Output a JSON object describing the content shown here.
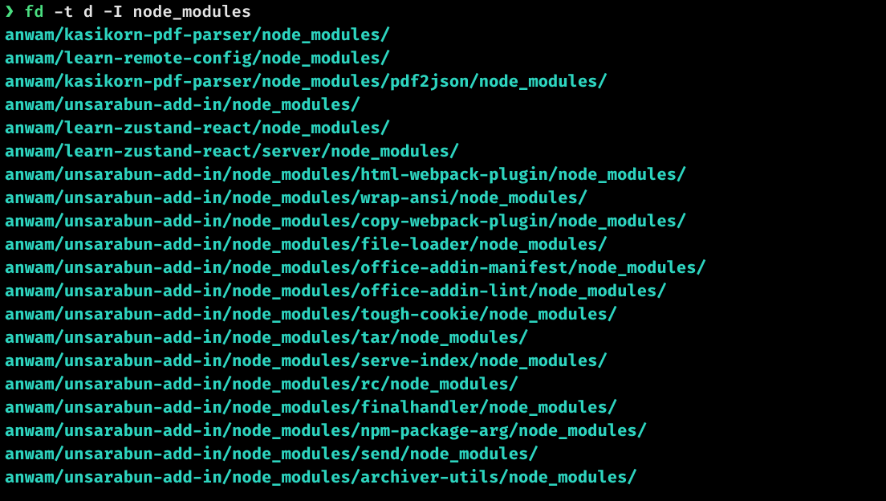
{
  "prompt": {
    "symbol": "❯",
    "command": "fd",
    "args": " -t d -I node_modules"
  },
  "output_lines": [
    "anwam/kasikorn-pdf-parser/node_modules/",
    "anwam/learn-remote-config/node_modules/",
    "anwam/kasikorn-pdf-parser/node_modules/pdf2json/node_modules/",
    "anwam/unsarabun-add-in/node_modules/",
    "anwam/learn-zustand-react/node_modules/",
    "anwam/learn-zustand-react/server/node_modules/",
    "anwam/unsarabun-add-in/node_modules/html-webpack-plugin/node_modules/",
    "anwam/unsarabun-add-in/node_modules/wrap-ansi/node_modules/",
    "anwam/unsarabun-add-in/node_modules/copy-webpack-plugin/node_modules/",
    "anwam/unsarabun-add-in/node_modules/file-loader/node_modules/",
    "anwam/unsarabun-add-in/node_modules/office-addin-manifest/node_modules/",
    "anwam/unsarabun-add-in/node_modules/office-addin-lint/node_modules/",
    "anwam/unsarabun-add-in/node_modules/tough-cookie/node_modules/",
    "anwam/unsarabun-add-in/node_modules/tar/node_modules/",
    "anwam/unsarabun-add-in/node_modules/serve-index/node_modules/",
    "anwam/unsarabun-add-in/node_modules/rc/node_modules/",
    "anwam/unsarabun-add-in/node_modules/finalhandler/node_modules/",
    "anwam/unsarabun-add-in/node_modules/npm-package-arg/node_modules/",
    "anwam/unsarabun-add-in/node_modules/send/node_modules/",
    "anwam/unsarabun-add-in/node_modules/archiver-utils/node_modules/"
  ]
}
